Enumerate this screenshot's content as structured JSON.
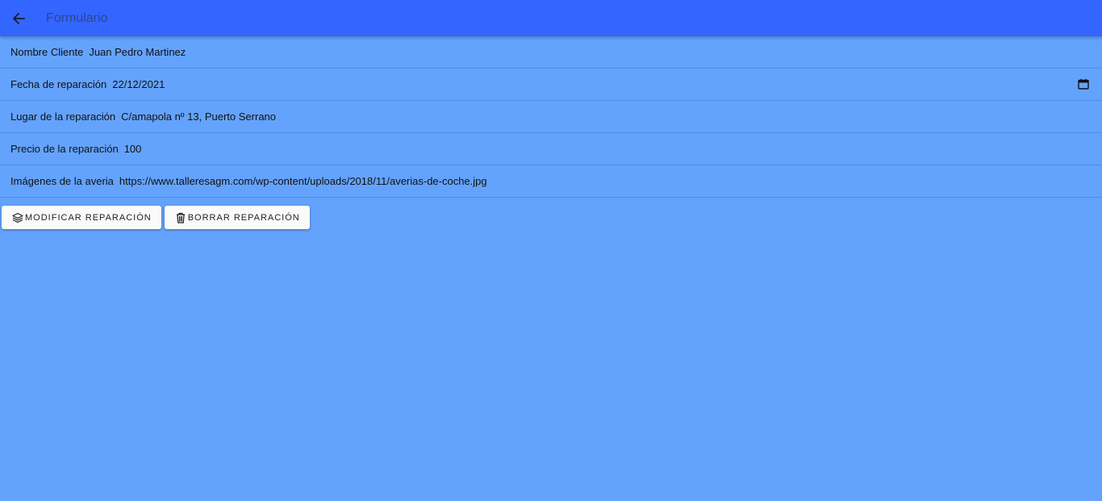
{
  "header": {
    "title": "Formulario",
    "back_icon": "arrow-back-icon",
    "background": "#3366ff"
  },
  "page": {
    "background": "#64a3fd"
  },
  "form": {
    "fields": [
      {
        "label": "Nombre Cliente",
        "value": "Juan Pedro Martinez"
      },
      {
        "label": "Fecha de reparación",
        "value": "22/12/2021",
        "icon": "calendar-icon"
      },
      {
        "label": "Lugar de la reparación",
        "value": "C/amapola nº 13, Puerto Serrano"
      },
      {
        "label": "Precio de la reparación",
        "value": "100"
      },
      {
        "label": "Imágenes de la averia",
        "value": "https://www.talleresagm.com/wp-content/uploads/2018/11/averias-de-coche.jpg"
      }
    ]
  },
  "actions": {
    "modify_label": "MODIFICAR REPARACIÓN",
    "modify_icon": "layers-icon",
    "delete_label": "BORRAR REPARACIÓN",
    "delete_icon": "trash-icon"
  }
}
